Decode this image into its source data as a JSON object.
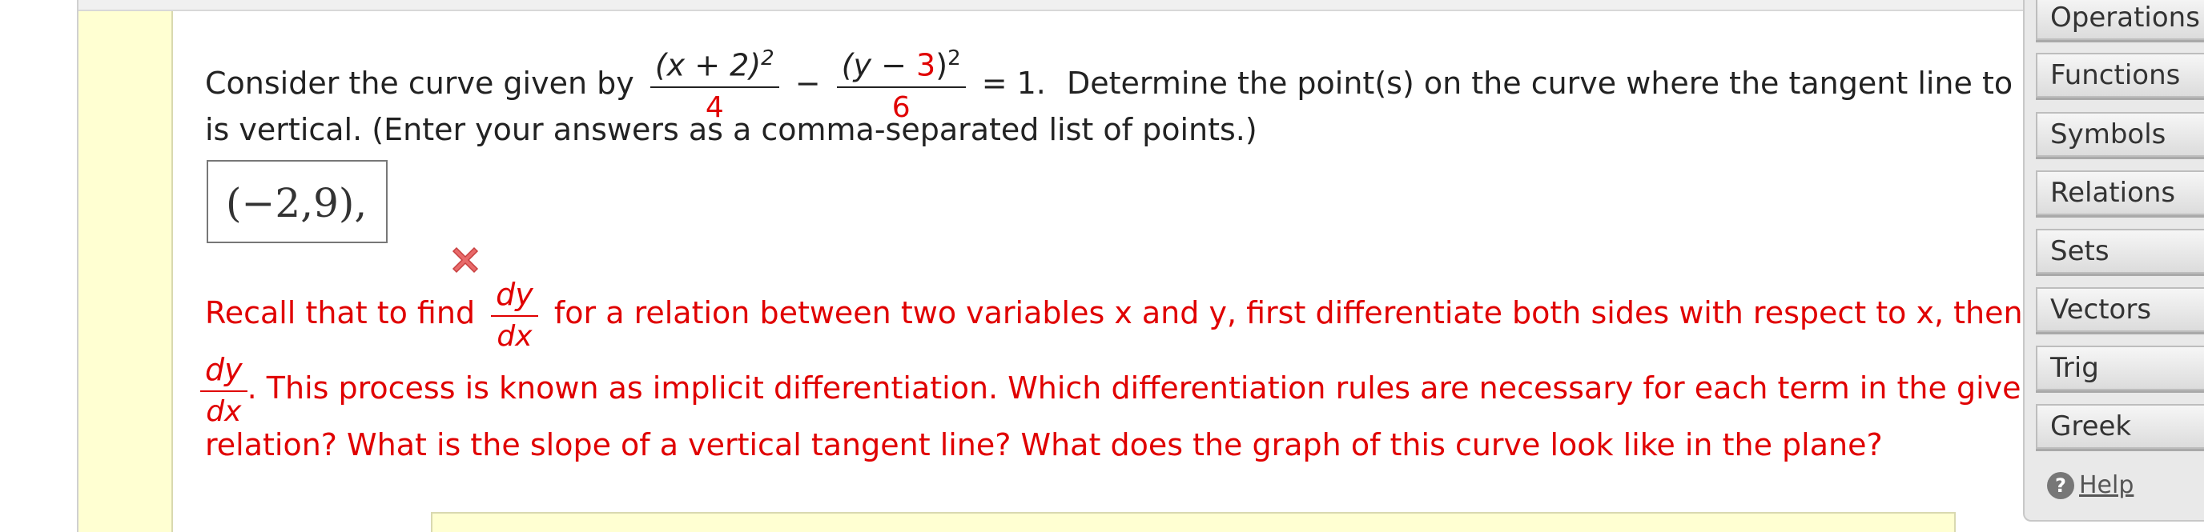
{
  "question": {
    "intro": "Consider the curve given by",
    "frac1": {
      "numerator_prefix": "(x + 2)",
      "numerator_exp": "2",
      "denominator": "4"
    },
    "minus": "−",
    "frac2": {
      "numerator_open": "(y − ",
      "numerator_red": "3",
      "numerator_close": ")",
      "numerator_exp": "2",
      "denominator": "6"
    },
    "equals": "= 1.",
    "rest_line1": "Determine the point(s) on the curve where the tangent line to the",
    "line2": "is vertical. (Enter your answers as a comma-separated list of points.)"
  },
  "answer": {
    "value": "(−2,9),"
  },
  "feedback": {
    "status": "incorrect",
    "line1_before": "Recall that to find",
    "dy": "dy",
    "dx": "dx",
    "line1_after": "for a relation between two variables x and y, first differentiate both sides with respect to x, then sol",
    "line2_after": ". This process is known as implicit differentiation. Which differentiation rules are necessary for each term in the given",
    "line3": "relation? What is the slope of a vertical tangent line? What does the graph of this curve look like in the plane?"
  },
  "palette": {
    "buttons": [
      "Operations",
      "Functions",
      "Symbols",
      "Relations",
      "Sets",
      "Vectors",
      "Trig",
      "Greek"
    ],
    "help_label": "Help"
  },
  "colors": {
    "error_red": "#e00000",
    "answer_strip": "#ffffd2"
  }
}
